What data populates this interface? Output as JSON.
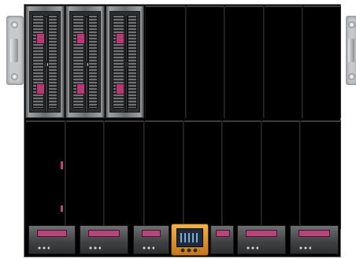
{
  "enclosure": {
    "type": "blade server enclosure front view",
    "upper_row": {
      "populated_blades": 3,
      "empty_bays": 5,
      "drive_tag_color": "#b43a72"
    },
    "lower_row": {
      "empty_bays": 8
    },
    "bottom_modules": {
      "count": 6,
      "accent_color": "#b5467a"
    },
    "onboard_display": {
      "icon": "lcd-display-icon",
      "frame_color": "#e09a30"
    },
    "icons": [
      "rack-ear-icon",
      "blade-server-icon",
      "hard-drive-icon",
      "power-supply-icon",
      "lcd-display-icon"
    ]
  }
}
